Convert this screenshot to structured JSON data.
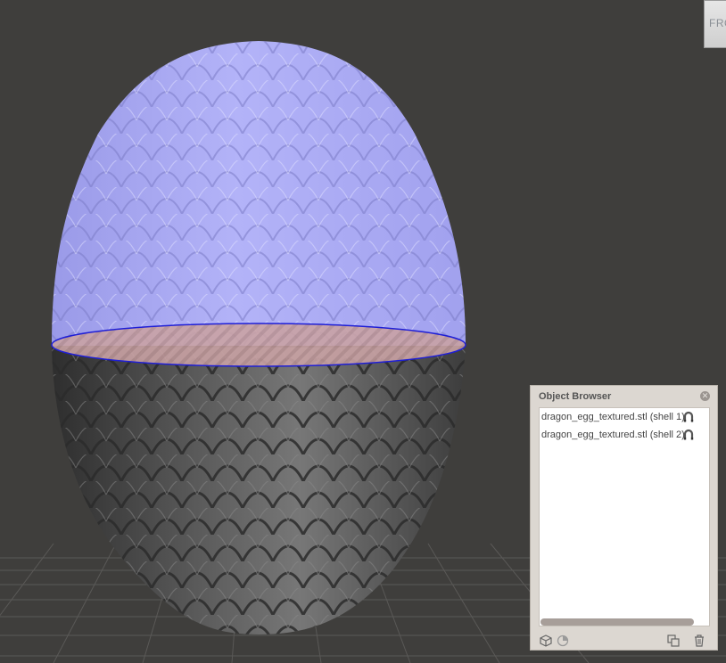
{
  "view_cube": {
    "label": "FRO"
  },
  "object_browser": {
    "title": "Object Browser",
    "close_icon": "close-icon",
    "items": [
      {
        "label": "dragon_egg_textured.stl (shell 1)",
        "icon": "magnet-icon"
      },
      {
        "label": "dragon_egg_textured.stl (shell 2)",
        "icon": "magnet-icon"
      }
    ],
    "footer_icons": [
      "cube-icon",
      "pie-icon",
      "duplicate-icon",
      "trash-icon"
    ]
  },
  "colors": {
    "background": "#3f3e3c",
    "upper_shell": "#a6a6f4",
    "lower_shell": "#6b6b6b",
    "cut_plane": "#c9a2a4",
    "cut_outline": "#1f1fd6"
  }
}
